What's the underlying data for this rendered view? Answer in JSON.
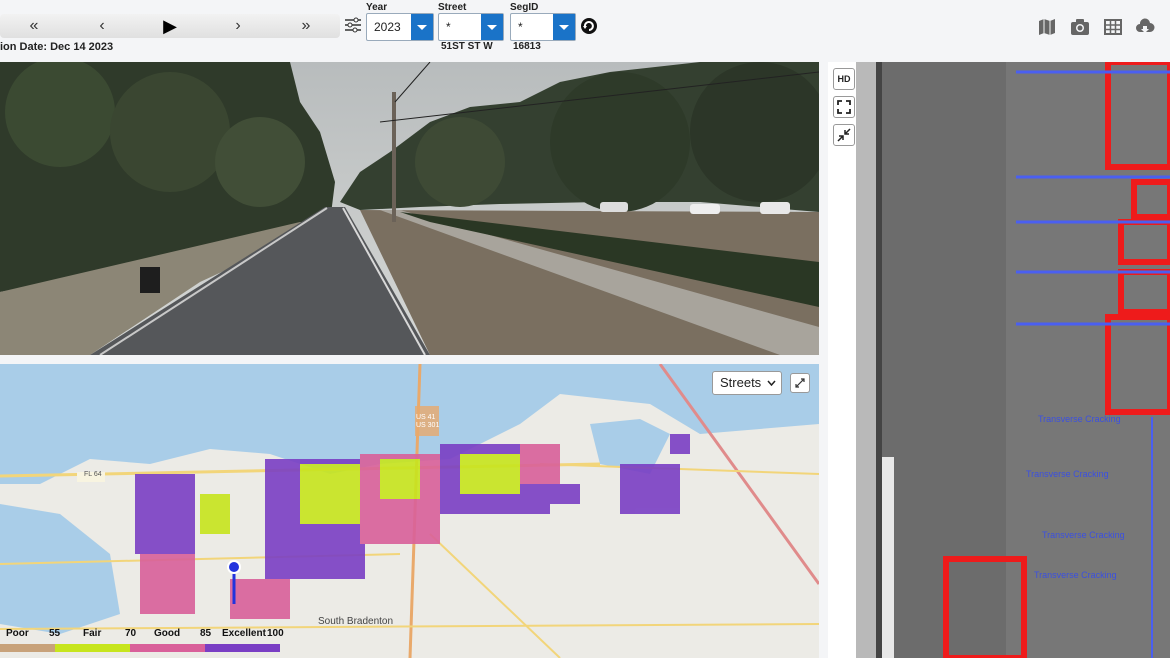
{
  "player": {
    "first": "«",
    "prev": "‹",
    "play": "▶",
    "next": "›",
    "last": "»"
  },
  "capture_date": "ion Date: Dec 14 2023",
  "filters": {
    "year": {
      "label": "Year",
      "value": "2023"
    },
    "street": {
      "label": "Street",
      "value": "*",
      "current": "51ST ST W"
    },
    "segid": {
      "label": "SegID",
      "value": "*",
      "current": "16813"
    }
  },
  "map": {
    "layer_select": "Streets",
    "highway_label": "FL 64",
    "place_label": "South Bradenton",
    "route_labels": [
      "US 41",
      "US 301"
    ]
  },
  "legend": {
    "labels": [
      "Poor",
      "55",
      "Fair",
      "70",
      "Good",
      "85",
      "Excellent",
      "100"
    ],
    "colors": [
      "#c8a27a",
      "#c7e51d",
      "#d9609a",
      "#7a3fc4"
    ]
  },
  "hd_tools": {
    "hd": "HD"
  },
  "pavement_labels": [
    "Transverse Cracking",
    "Transverse Cracking",
    "Transverse Cracking",
    "Transverse Cracking"
  ],
  "icons": [
    "map-icon",
    "camera-icon",
    "table-icon",
    "cloud-download-icon"
  ]
}
